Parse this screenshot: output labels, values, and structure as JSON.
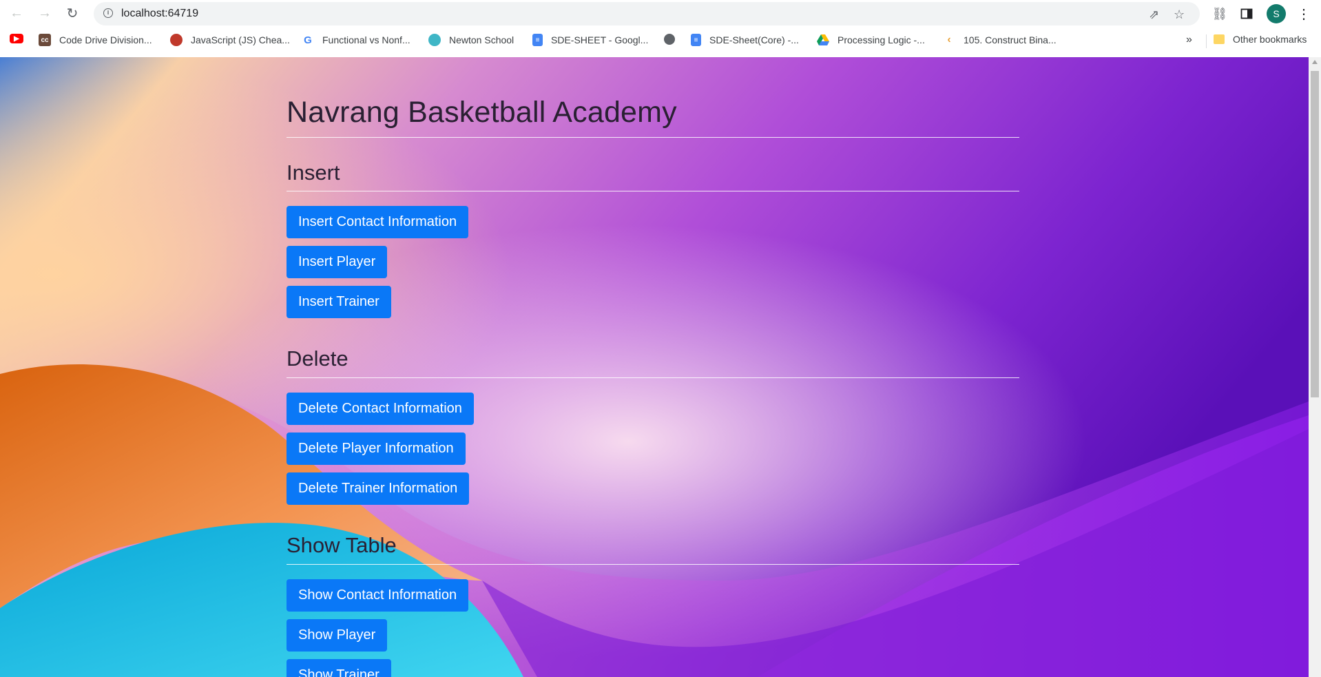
{
  "browser": {
    "url": "localhost:64719",
    "avatar_letter": "S",
    "bookmarks": [
      {
        "label": "",
        "icon": "youtube-icon"
      },
      {
        "label": "Code Drive Division...",
        "icon": "cc-icon"
      },
      {
        "label": "JavaScript (JS) Chea...",
        "icon": "js-cheatsheet-icon"
      },
      {
        "label": "Functional vs Nonf...",
        "icon": "google-icon"
      },
      {
        "label": "Newton School",
        "icon": "newton-icon"
      },
      {
        "label": "SDE-SHEET - Googl...",
        "icon": "docs-icon"
      },
      {
        "label": "",
        "icon": "globe-icon"
      },
      {
        "label": "SDE-Sheet(Core) -...",
        "icon": "docs-icon"
      },
      {
        "label": "Processing Logic -...",
        "icon": "drive-icon"
      },
      {
        "label": "105. Construct Bina...",
        "icon": "leetcode-icon"
      }
    ],
    "overflow": "»",
    "other_bookmarks": "Other bookmarks"
  },
  "page": {
    "title": "Navrang Basketball Academy",
    "sections": [
      {
        "heading": "Insert",
        "buttons": [
          "Insert Contact Information",
          "Insert Player",
          "Insert Trainer"
        ]
      },
      {
        "heading": "Delete",
        "buttons": [
          "Delete Contact Information",
          "Delete Player Information",
          "Delete Trainer Information"
        ]
      },
      {
        "heading": "Show Table",
        "buttons": [
          "Show Contact Information",
          "Show Player",
          "Show Trainer"
        ]
      }
    ]
  },
  "colors": {
    "button": "#0a78f7",
    "heading": "#2a2033",
    "avatar": "#137b6c"
  }
}
